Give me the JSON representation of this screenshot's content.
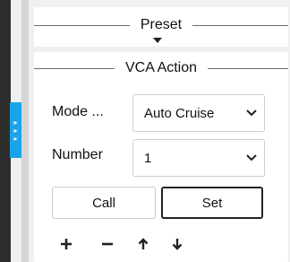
{
  "preset": {
    "title": "Preset"
  },
  "vca": {
    "title": "VCA Action",
    "mode": {
      "label": "Mode ...",
      "value": "Auto Cruise"
    },
    "number": {
      "label": "Number",
      "value": "1"
    },
    "buttons": {
      "call": "Call",
      "set": "Set"
    }
  },
  "toolbar": {
    "icons": [
      "plus-icon",
      "minus-icon",
      "arrow-up-icon",
      "arrow-down-icon"
    ]
  },
  "colors": {
    "accent": "#1aa3e8",
    "left_bar": "#2e2e2e",
    "panel_bg": "#f0f0f0",
    "card_bg": "#ffffff"
  }
}
